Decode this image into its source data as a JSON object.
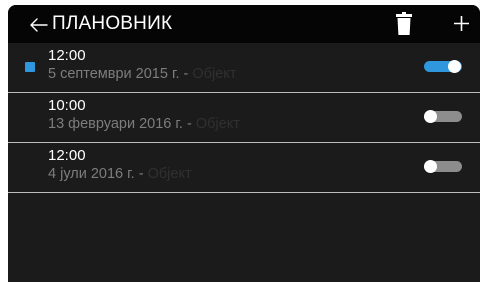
{
  "header": {
    "title": "ПЛАНОВНИК",
    "back_icon": "back-arrow-icon",
    "delete_icon": "trash-icon",
    "add_icon": "plus-icon"
  },
  "colors": {
    "accent": "#2f97de",
    "background": "#1b1b1b",
    "topbar": "#050505",
    "divider": "#bdbdbd"
  },
  "schedules": [
    {
      "time": "12:00",
      "date": "5 септември 2015 г.",
      "separator": "-",
      "object": "Објект",
      "enabled": true,
      "selected": true
    },
    {
      "time": "10:00",
      "date": "13 февруари 2016 г.",
      "separator": "-",
      "object": "Објект",
      "enabled": false,
      "selected": false
    },
    {
      "time": "12:00",
      "date": "4 јули 2016 г.",
      "separator": "-",
      "object": "Објект",
      "enabled": false,
      "selected": false
    }
  ]
}
